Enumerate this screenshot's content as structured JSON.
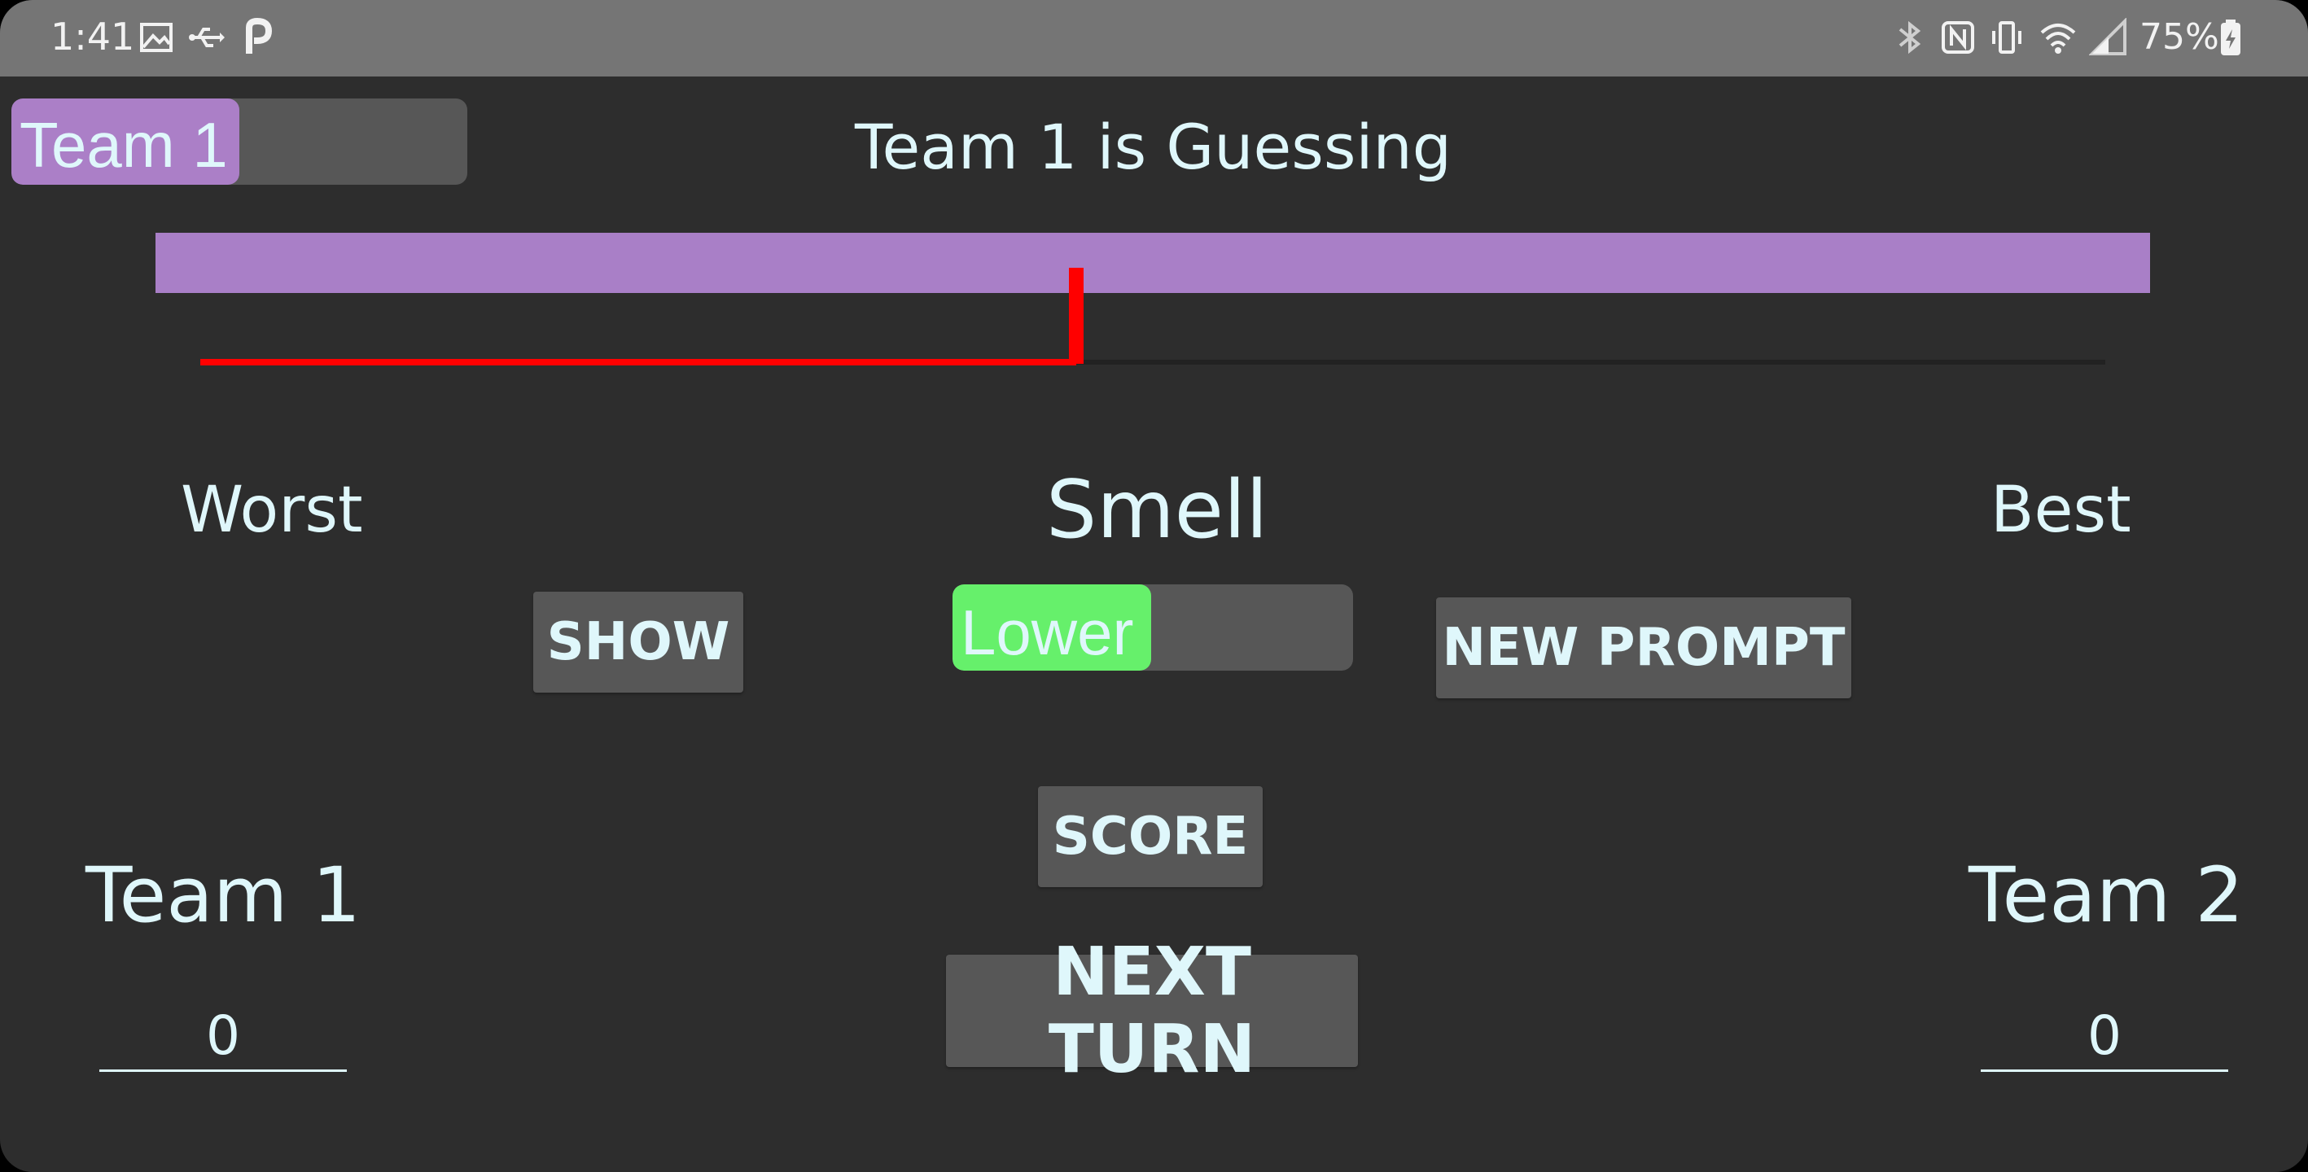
{
  "status_bar": {
    "time": "1:41",
    "battery_percent": "75%",
    "icons": [
      "image-icon",
      "usb-icon",
      "p-app-icon",
      "bluetooth-icon",
      "nfc-icon",
      "vibrate-icon",
      "wifi-icon",
      "signal-icon",
      "battery-charging-icon"
    ]
  },
  "team_toggle": {
    "label": "Team 1",
    "on": false,
    "thumb_color": "#ab7fc7"
  },
  "guessing_title": "Team 1 is Guessing",
  "slider": {
    "value_fraction": 0.46,
    "bar_color": "#a97fc7",
    "indicator_color": "#ff0000"
  },
  "scale": {
    "left_label": "Worst",
    "prompt": "Smell",
    "right_label": "Best"
  },
  "buttons": {
    "show": "SHOW",
    "new_prompt": "NEW PROMPT",
    "score": "SCORE",
    "next_turn": "NEXT TURN"
  },
  "direction_toggle": {
    "label": "Lower",
    "on": false,
    "thumb_color": "#66f06b"
  },
  "teams": [
    {
      "name": "Team 1",
      "score": "0"
    },
    {
      "name": "Team 2",
      "score": "0"
    }
  ]
}
